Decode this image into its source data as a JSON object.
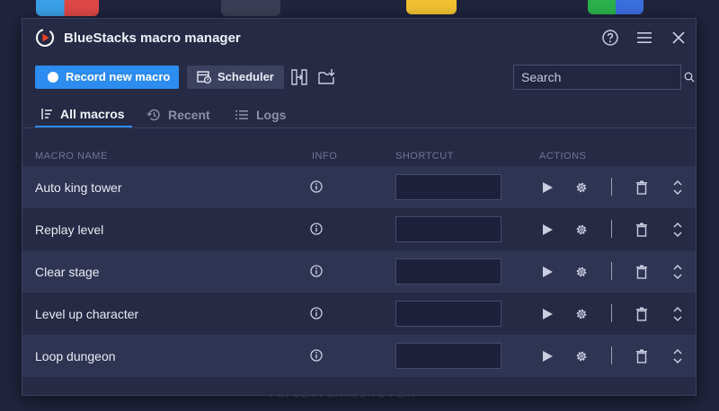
{
  "window": {
    "title": "BlueStacks macro manager"
  },
  "toolbar": {
    "record_label": "Record new macro",
    "scheduler_label": "Scheduler",
    "search_placeholder": "Search"
  },
  "tabs": [
    {
      "label": "All macros",
      "active": true,
      "icon": "sort-icon"
    },
    {
      "label": "Recent",
      "active": false,
      "icon": "history-icon"
    },
    {
      "label": "Logs",
      "active": false,
      "icon": "list-icon"
    }
  ],
  "table": {
    "headers": {
      "name": "MACRO NAME",
      "info": "INFO",
      "shortcut": "SHORTCUT",
      "actions": "ACTIONS"
    },
    "rows": [
      {
        "name": "Auto king tower",
        "shortcut": ""
      },
      {
        "name": "Replay level",
        "shortcut": ""
      },
      {
        "name": "Clear stage",
        "shortcut": ""
      },
      {
        "name": "Level up character",
        "shortcut": ""
      },
      {
        "name": "Loop dungeon",
        "shortcut": ""
      }
    ]
  },
  "background": {
    "footer_text": "POPULAR GAMES TO PLAY"
  },
  "colors": {
    "accent": "#2d8cf0",
    "window_bg": "#262a44",
    "row_alt": "#2f3453"
  }
}
